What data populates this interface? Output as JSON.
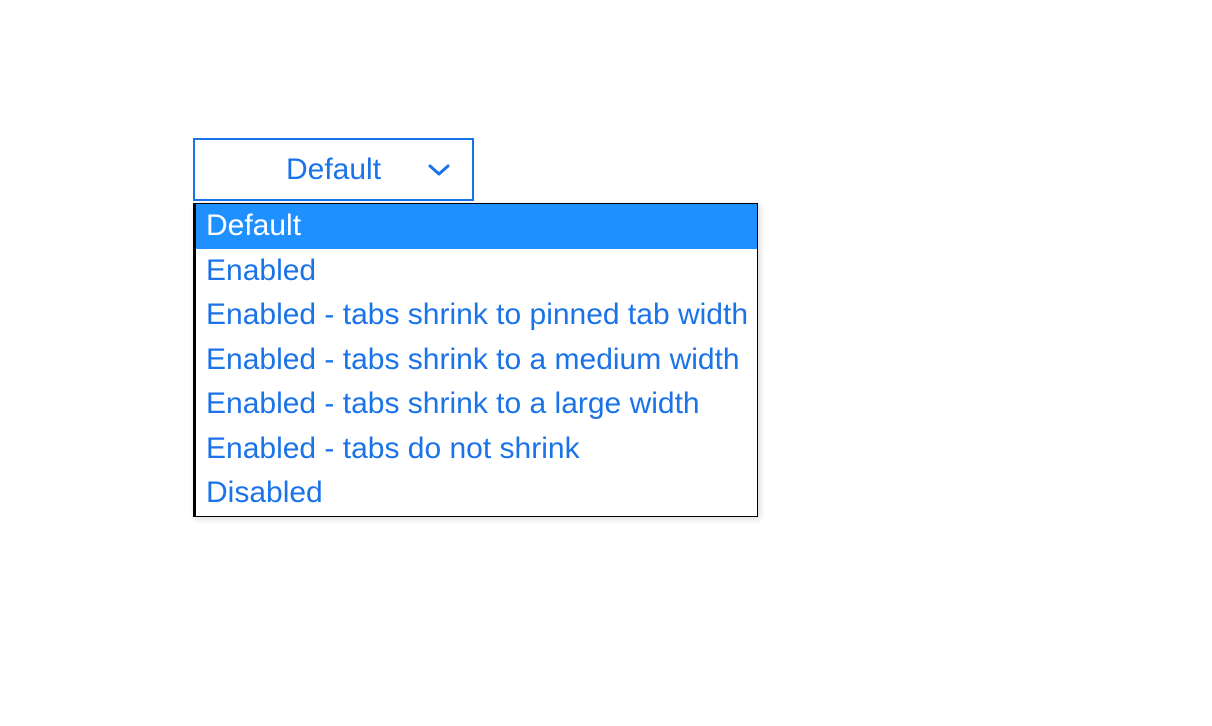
{
  "dropdown": {
    "selected": "Default",
    "options": [
      "Default",
      "Enabled",
      "Enabled - tabs shrink to pinned tab width",
      "Enabled - tabs shrink to a medium width",
      "Enabled - tabs shrink to a large width",
      "Enabled - tabs do not shrink",
      "Disabled"
    ],
    "selectedIndex": 0
  },
  "colors": {
    "accent": "#1a73e8",
    "highlight": "#1e90ff"
  }
}
